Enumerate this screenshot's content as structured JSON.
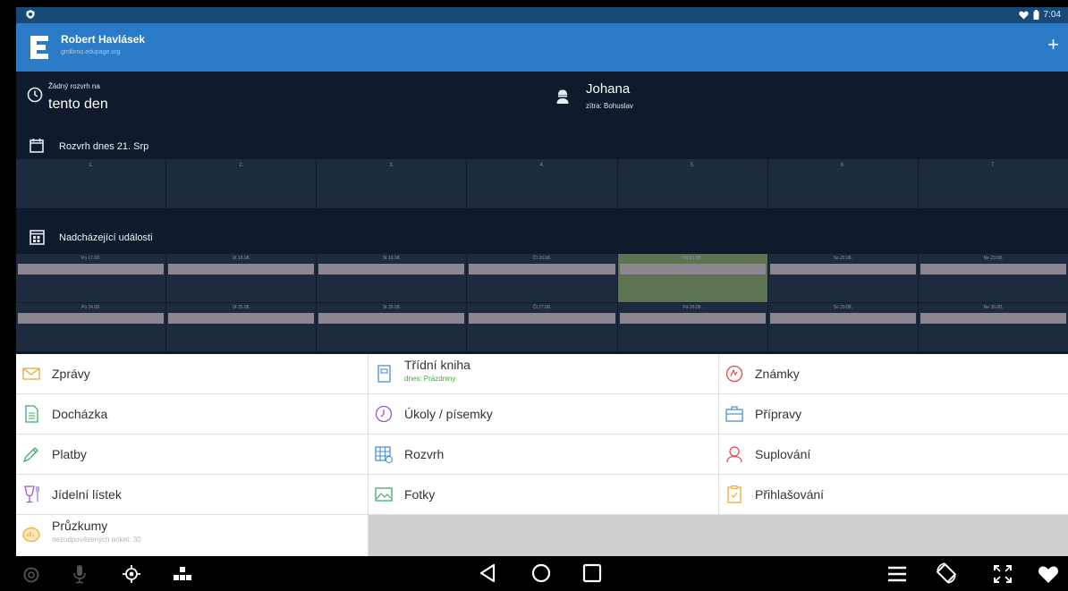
{
  "status_bar": {
    "time": "7:04"
  },
  "app_bar": {
    "user_name": "Robert Havlásek",
    "domain": "gmlbrno.edupage.org",
    "add_label": "+"
  },
  "today": {
    "small": "Žádný rozvrh na",
    "big": "tento den"
  },
  "nameday": {
    "name": "Johana",
    "tomorrow": "zítra: Bohuslav"
  },
  "timetable": {
    "title": "Rozvrh dnes 21. Srp",
    "periods": [
      "1.",
      "2.",
      "3.",
      "4.",
      "5.",
      "6.",
      "7."
    ]
  },
  "events": {
    "title": "Nadcházející události",
    "week1": [
      "Po 17.08.",
      "Út 18.08.",
      "St 19.08.",
      "Čt 20.08.",
      "Pá 21.08.",
      "So 22.08.",
      "Ne 23.08."
    ],
    "week2": [
      "Po 24.08.",
      "Út 25.08.",
      "St 26.08.",
      "Čt 27.08.",
      "Pá 28.08.",
      "So 29.08.",
      "Ne 30.08."
    ]
  },
  "menu": {
    "zpravy": "Zprávy",
    "tridni_kniha": "Třídní kniha",
    "tridni_kniha_sub": "dnes: Prázdniny",
    "znamky": "Známky",
    "dochazka": "Docházka",
    "ukoly": "Úkoly / písemky",
    "pripravy": "Přípravy",
    "platby": "Platby",
    "rozvrh": "Rozvrh",
    "suplovani": "Suplování",
    "jidelni_listek": "Jídelní lístek",
    "fotky": "Fotky",
    "prihlasovani": "Přihlašování",
    "pruzkumy": "Průzkumy",
    "pruzkumy_sub": "nezodpovězených anket: 30"
  },
  "colors": {
    "statusbar": "#174a77",
    "appbar": "#2b7bc6",
    "dashboard": "#0f1b2d",
    "cell": "#1e2a3d",
    "today_cell": "#5d7352",
    "event_bar": "#8c8592"
  },
  "icons": {
    "status_left": "shield-icon",
    "status_right": [
      "heart-icon",
      "battery-icon"
    ],
    "nav": [
      "camera-icon",
      "mic-icon",
      "gps-icon",
      "apps-icon",
      "back-icon",
      "home-icon",
      "recents-icon",
      "menu-icon",
      "rotate-icon",
      "fullscreen-icon",
      "heart-icon"
    ]
  }
}
